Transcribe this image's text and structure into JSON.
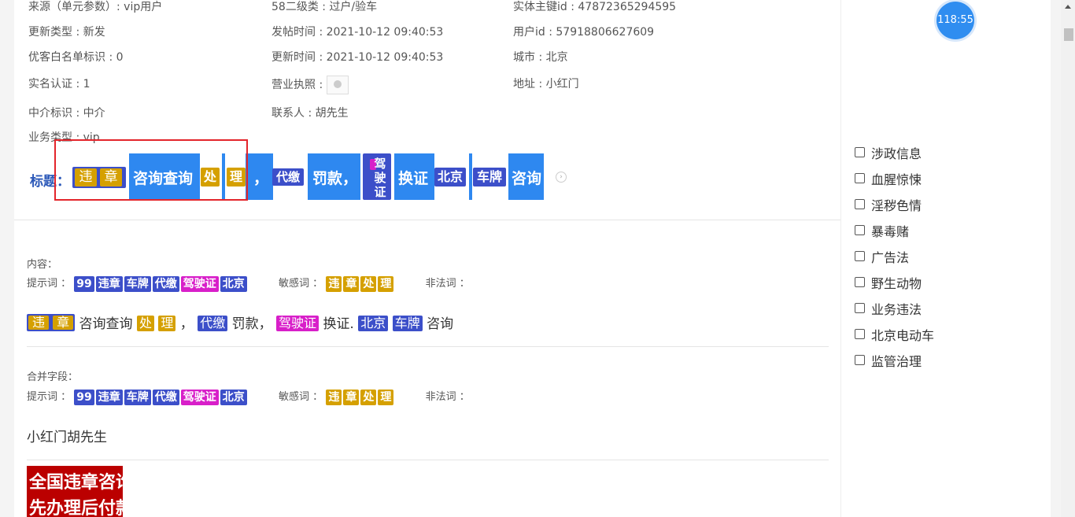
{
  "meta": {
    "source": "来源（单元参数）: vip用户",
    "category": "58二级类 : 过户/验车",
    "entity_id": "实体主键id : 47872365294595",
    "update_type": "更新类型 : 新发",
    "post_time": "发帖时间 : 2021-10-12 09:40:53",
    "user_id": "用户id : 57918806627609",
    "whitelist": "优客白名单标识 : 0",
    "update_time": "更新时间 : 2021-10-12 09:40:53",
    "city": "城市 : 北京",
    "realname": "实名认证 : 1",
    "license": "营业执照 :",
    "address": "地址 : 小红门",
    "agent": "中介标识 : 中介",
    "contact": "联系人 : 胡先生",
    "biz_type": "业务类型 : vip"
  },
  "title": {
    "label": "标题：",
    "tag_wz1": "违",
    "tag_wz2": "章",
    "seg_zixun": "咨询查询",
    "tag_chu": "处",
    "tag_li": "理",
    "comma1": "，",
    "tag_daijiao": "代缴",
    "seg_fakuan": "罚款，",
    "tag_jiazheng": "驾驶证",
    "seg_huanzheng": "换证",
    "tag_beijing": "北京",
    "tag_chepai": "车牌",
    "seg_zixun2": "咨询"
  },
  "content": {
    "label": "内容：",
    "hint_label": "提示词 ：",
    "hint_tags": [
      "99",
      "违章",
      "车牌",
      "代缴",
      "驾驶证",
      "北京"
    ],
    "sensitive_label": "敏感词 ：",
    "sensitive_tags": [
      "违",
      "章",
      "处",
      "理"
    ],
    "illegal_label": "非法词 ：",
    "text": {
      "wei": "违",
      "zhang": "章",
      "zixun": "咨询查询",
      "chu": "处",
      "li": "理",
      "comma": "，",
      "daijiao": "代缴",
      "fakuan": "罚款，",
      "jiazheng": "驾驶证",
      "huanzheng": "换证.",
      "beijing": "北京",
      "chepai": "车牌",
      "zixun2": "咨询"
    }
  },
  "merged": {
    "label": "合并字段：",
    "hint_label": "提示词 ：",
    "hint_tags": [
      "99",
      "违章",
      "车牌",
      "代缴",
      "驾驶证",
      "北京"
    ],
    "sensitive_label": "敏感词 ：",
    "sensitive_tags": [
      "违",
      "章",
      "处",
      "理"
    ],
    "illegal_label": "非法词 ：",
    "text": "小红门胡先生"
  },
  "image_text": {
    "line1": "全国违章咨询",
    "line2": "先办理后付款"
  },
  "timer": "118:55",
  "checkboxes": [
    "涉政信息",
    "血腥惊悚",
    "淫秽色情",
    "暴毒赌",
    "广告法",
    "野生动物",
    "业务违法",
    "北京电动车",
    "监管治理"
  ],
  "colors": {
    "tag_blue": "#3c4fc9",
    "tag_gold": "#d5a000",
    "tag_magenta": "#d81fc9",
    "label_blue": "#2e88f0",
    "highlight_red": "#e3252b"
  }
}
